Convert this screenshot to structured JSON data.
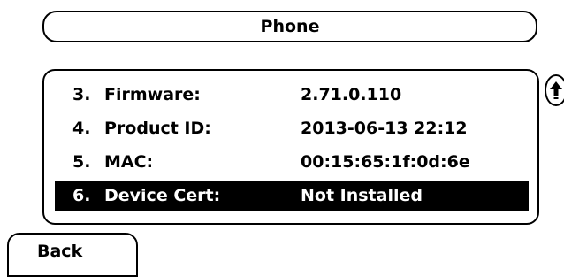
{
  "header": {
    "title": "Phone"
  },
  "info_list": {
    "rows": [
      {
        "number": "3.",
        "label": "Firmware:",
        "value": "2.71.0.110",
        "selected": false
      },
      {
        "number": "4.",
        "label": "Product ID:",
        "value": "2013-06-13 22:12",
        "selected": false
      },
      {
        "number": "5.",
        "label": "MAC:",
        "value": "00:15:65:1f:0d:6e",
        "selected": false
      },
      {
        "number": "6.",
        "label": "Device Cert:",
        "value": "Not Installed",
        "selected": true
      }
    ]
  },
  "scroll_indicator": {
    "icon": "arrow-up-icon"
  },
  "softkeys": {
    "back_label": "Back"
  },
  "colors": {
    "foreground": "#000000",
    "background": "#ffffff",
    "selection_bg": "#000000",
    "selection_fg": "#ffffff"
  }
}
